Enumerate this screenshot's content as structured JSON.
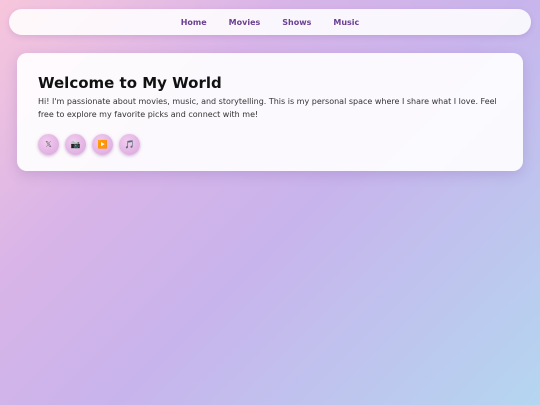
{
  "nav": {
    "links": [
      "Home",
      "Movies",
      "Shows",
      "Music"
    ]
  },
  "hero": {
    "title": "Welcome to My World",
    "intro": "Hi! I'm passionate about movies, music, and storytelling. This is my personal space where I share what I love. Feel free to explore my favorite picks and connect with me!"
  },
  "social": {
    "icons": [
      {
        "name": "twitter-icon",
        "glyph": "𝕏"
      },
      {
        "name": "camera-icon",
        "glyph": "📷"
      },
      {
        "name": "youtube-icon",
        "glyph": "▶️"
      },
      {
        "name": "music-icon",
        "glyph": "🎵"
      }
    ]
  },
  "colors": {
    "nav_text": "#6b3f92",
    "icon_bg": "#d8a4dc"
  }
}
